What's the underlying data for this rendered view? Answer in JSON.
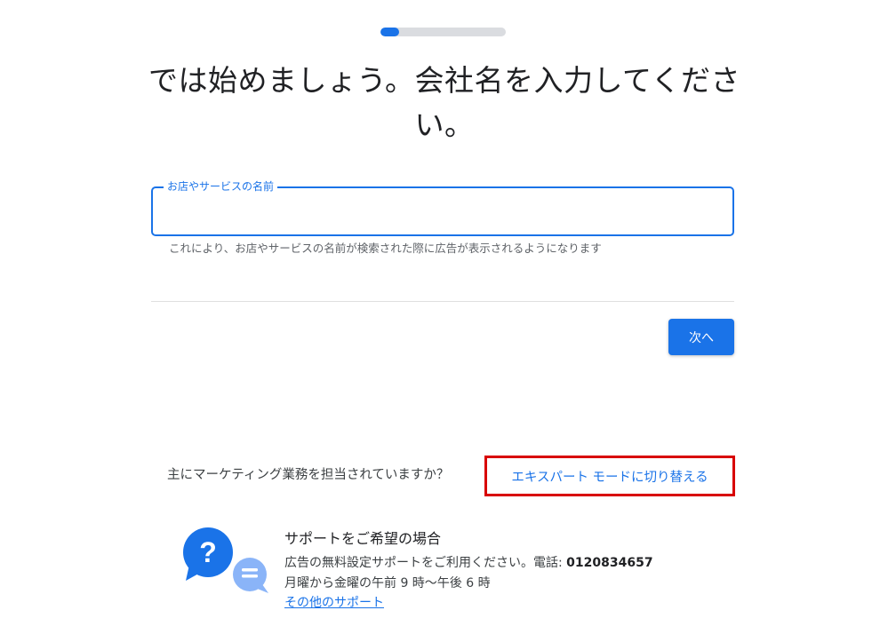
{
  "progress": {
    "fraction": 0.15,
    "fill_color": "#1a73e8",
    "track_color": "#dadce0"
  },
  "title": "では始めましょう。会社名を入力してください。",
  "business_name_field": {
    "label": "お店やサービスの名前",
    "value": "",
    "helper": "これにより、お店やサービスの名前が検索された際に広告が表示されるようになります"
  },
  "next_button": {
    "label": "次へ"
  },
  "expert_mode": {
    "question": "主にマーケティング業務を担当されていますか？",
    "link": "エキスパート モードに切り替える",
    "highlight_color": "#d80000"
  },
  "support": {
    "icon": "support-chat-icon",
    "title": "サポートをご希望の場合",
    "description": "広告の無料設定サポートをご利用ください。電話: ",
    "phone": "0120834657",
    "hours": "月曜から金曜の午前 9 時～午後 6 時",
    "link": "その他のサポート"
  },
  "colors": {
    "accent": "#1a73e8",
    "text": "#202124",
    "secondary_text": "#5f6368"
  }
}
